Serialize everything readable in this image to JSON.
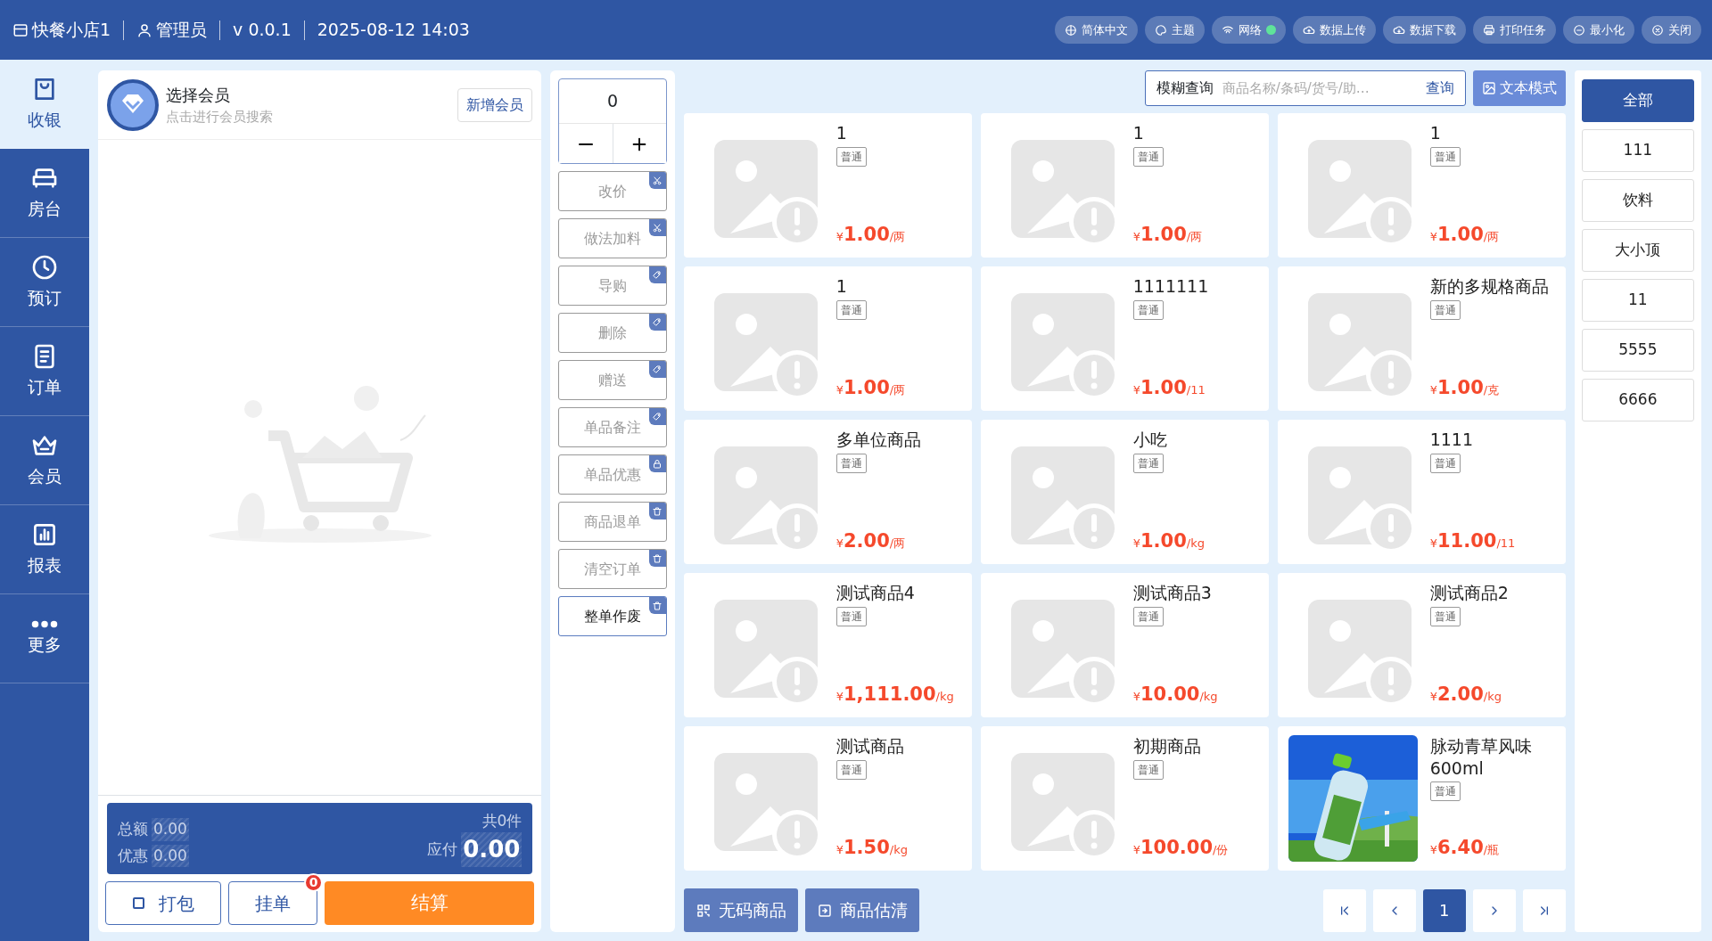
{
  "topbar": {
    "shop": "快餐小店1",
    "user": "管理员",
    "version": "v 0.0.1",
    "datetime": "2025-08-12 14:03",
    "actions": [
      {
        "label": "简体中文"
      },
      {
        "label": "主题"
      },
      {
        "label": "网络",
        "connected": true
      },
      {
        "label": "数据上传"
      },
      {
        "label": "数据下载"
      },
      {
        "label": "打印任务"
      },
      {
        "label": "最小化"
      },
      {
        "label": "关闭"
      }
    ]
  },
  "sidebar": {
    "items": [
      {
        "label": "收银",
        "selected": true
      },
      {
        "label": "房台",
        "selected": false
      },
      {
        "label": "预订",
        "selected": false
      },
      {
        "label": "订单",
        "selected": false
      },
      {
        "label": "会员",
        "selected": false
      },
      {
        "label": "报表",
        "selected": false
      },
      {
        "label": "更多",
        "selected": false
      }
    ]
  },
  "member": {
    "title": "选择会员",
    "hint": "点击进行会员搜索",
    "add_button": "新增会员"
  },
  "summary": {
    "total_label": "总额",
    "total": "0.00",
    "discount_label": "优惠",
    "discount": "0.00",
    "count": "共0件",
    "payable_label": "应付",
    "payable": "0.00"
  },
  "order_buttons": {
    "pack": {
      "label": "打包",
      "checked": false
    },
    "hold": {
      "label": "挂单",
      "badge": "0"
    },
    "checkout": "结算"
  },
  "quantity": {
    "value": "0"
  },
  "operations": [
    {
      "label": "改价",
      "kind": "scissors",
      "disabled": true
    },
    {
      "label": "做法加料",
      "kind": "scissors",
      "disabled": true
    },
    {
      "label": "导购",
      "kind": "tag",
      "disabled": true
    },
    {
      "label": "删除",
      "kind": "tag",
      "disabled": true
    },
    {
      "label": "赠送",
      "kind": "tag",
      "disabled": true
    },
    {
      "label": "单品备注",
      "kind": "tag",
      "disabled": true
    },
    {
      "label": "单品优惠",
      "kind": "lock",
      "disabled": true
    },
    {
      "label": "商品退单",
      "kind": "trash",
      "disabled": true
    },
    {
      "label": "清空订单",
      "kind": "trash",
      "disabled": true
    },
    {
      "label": "整单作废",
      "kind": "trash",
      "disabled": false
    }
  ],
  "search": {
    "label": "模糊查询",
    "placeholder": "商品名称/条码/货号/助…",
    "button": "查询",
    "mode_button": "文本模式"
  },
  "products": [
    {
      "name": "1",
      "tag": "普通",
      "currency": "¥",
      "price": "1.00",
      "unit": "/两",
      "kind": "placeholder"
    },
    {
      "name": "1",
      "tag": "普通",
      "currency": "¥",
      "price": "1.00",
      "unit": "/两",
      "kind": "placeholder"
    },
    {
      "name": "1",
      "tag": "普通",
      "currency": "¥",
      "price": "1.00",
      "unit": "/两",
      "kind": "placeholder"
    },
    {
      "name": "1",
      "tag": "普通",
      "currency": "¥",
      "price": "1.00",
      "unit": "/两",
      "kind": "placeholder"
    },
    {
      "name": "1111111",
      "tag": "普通",
      "currency": "¥",
      "price": "1.00",
      "unit": "/11",
      "kind": "placeholder"
    },
    {
      "name": "新的多规格商品",
      "tag": "普通",
      "currency": "¥",
      "price": "1.00",
      "unit": "/克",
      "kind": "placeholder"
    },
    {
      "name": "多单位商品",
      "tag": "普通",
      "currency": "¥",
      "price": "2.00",
      "unit": "/两",
      "kind": "placeholder"
    },
    {
      "name": "小吃",
      "tag": "普通",
      "currency": "¥",
      "price": "1.00",
      "unit": "/kg",
      "kind": "placeholder"
    },
    {
      "name": "1111",
      "tag": "普通",
      "currency": "¥",
      "price": "11.00",
      "unit": "/11",
      "kind": "placeholder"
    },
    {
      "name": "测试商品4",
      "tag": "普通",
      "currency": "¥",
      "price": "1,111.00",
      "unit": "/kg",
      "kind": "placeholder"
    },
    {
      "name": "测试商品3",
      "tag": "普通",
      "currency": "¥",
      "price": "10.00",
      "unit": "/kg",
      "kind": "placeholder"
    },
    {
      "name": "测试商品2",
      "tag": "普通",
      "currency": "¥",
      "price": "2.00",
      "unit": "/kg",
      "kind": "placeholder"
    },
    {
      "name": "测试商品",
      "tag": "普通",
      "currency": "¥",
      "price": "1.50",
      "unit": "/kg",
      "kind": "placeholder"
    },
    {
      "name": "初期商品",
      "tag": "普通",
      "currency": "¥",
      "price": "100.00",
      "unit": "/份",
      "kind": "placeholder"
    },
    {
      "name": "脉动青草风味600ml",
      "tag": "普通",
      "currency": "¥",
      "price": "6.40",
      "unit": "/瓶",
      "kind": "picture"
    }
  ],
  "bottom_buttons": [
    "无码商品",
    "商品估清"
  ],
  "pagination": {
    "pages": [
      {
        "label": "1",
        "selected": true
      }
    ]
  },
  "categories": [
    {
      "label": "全部",
      "selected": true
    },
    {
      "label": "111",
      "selected": false
    },
    {
      "label": "饮料",
      "selected": false
    },
    {
      "label": "大小顶",
      "selected": false
    },
    {
      "label": "11",
      "selected": false
    },
    {
      "label": "5555",
      "selected": false
    },
    {
      "label": "6666",
      "selected": false
    }
  ]
}
